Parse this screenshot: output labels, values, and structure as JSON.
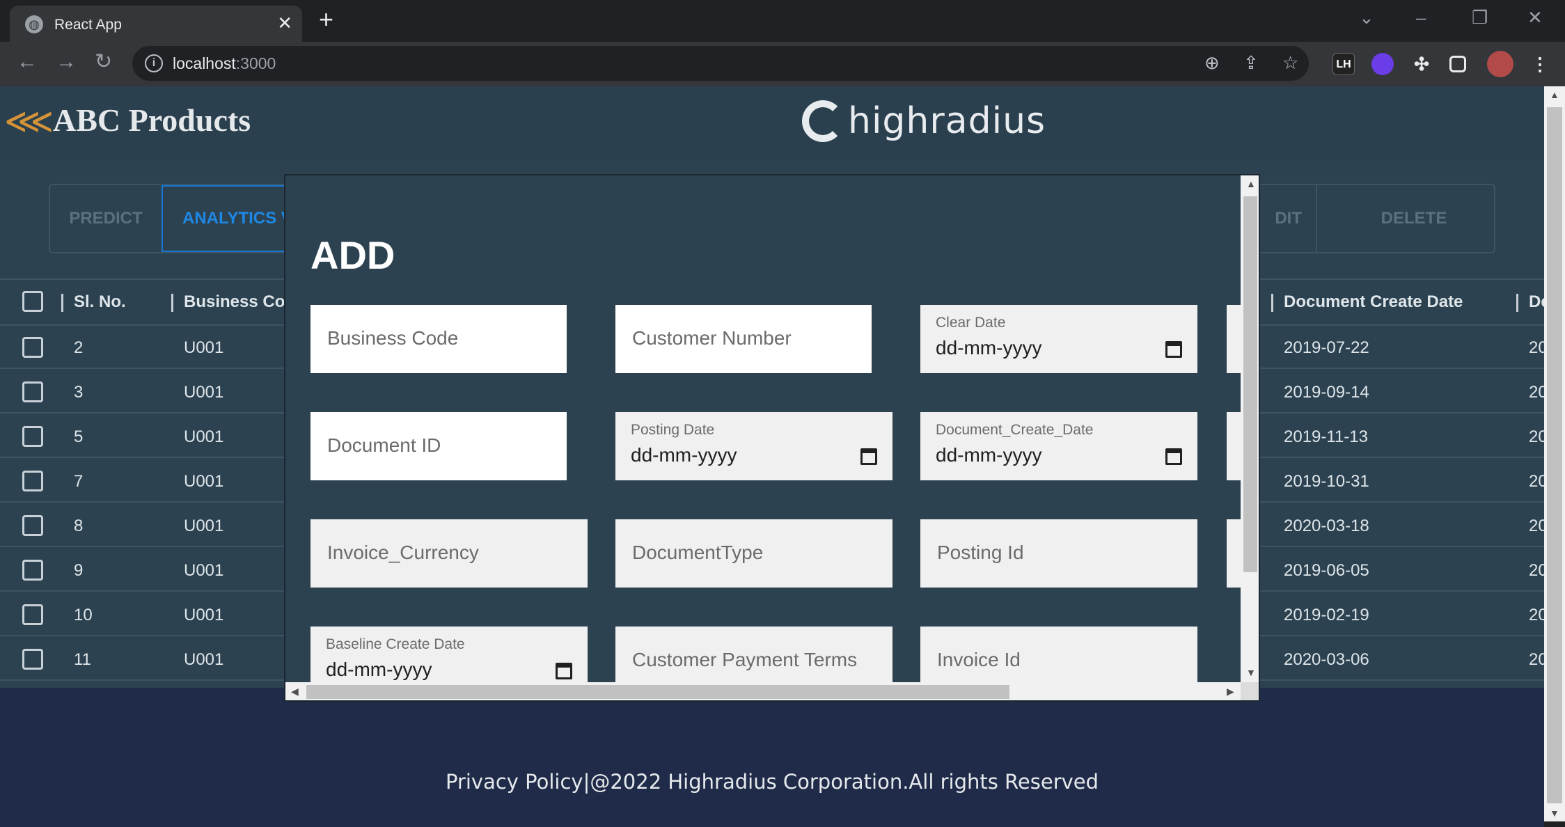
{
  "browser": {
    "tab_title": "React App",
    "tab_close": "✕",
    "new_tab": "+",
    "url_host": "localhost",
    "url_port": ":3000",
    "extensions": {
      "lh": "LH"
    }
  },
  "header": {
    "brand": "ABC Products",
    "partner_logo": "highradius"
  },
  "actions": {
    "predict": "PREDICT",
    "analytics": "ANALYTICS V",
    "edit": "DIT",
    "delete": "DELETE"
  },
  "grid": {
    "columns": {
      "sl_no": "Sl. No.",
      "business_code": "Business Co",
      "document_create_date": "Document Create Date",
      "next": "De"
    },
    "rows": [
      {
        "sl_no": "2",
        "business_code": "U001",
        "document_create_date": "2019-07-22",
        "next": "20"
      },
      {
        "sl_no": "3",
        "business_code": "U001",
        "document_create_date": "2019-09-14",
        "next": "20"
      },
      {
        "sl_no": "5",
        "business_code": "U001",
        "document_create_date": "2019-11-13",
        "next": "20"
      },
      {
        "sl_no": "7",
        "business_code": "U001",
        "document_create_date": "2019-10-31",
        "next": "20"
      },
      {
        "sl_no": "8",
        "business_code": "U001",
        "document_create_date": "2020-03-18",
        "next": "20"
      },
      {
        "sl_no": "9",
        "business_code": "U001",
        "document_create_date": "2019-06-05",
        "next": "20"
      },
      {
        "sl_no": "10",
        "business_code": "U001",
        "document_create_date": "2019-02-19",
        "next": "20"
      },
      {
        "sl_no": "11",
        "business_code": "U001",
        "document_create_date": "2020-03-06",
        "next": "20"
      }
    ]
  },
  "modal": {
    "title": "ADD",
    "fields": {
      "business_code": {
        "placeholder": "Business Code"
      },
      "customer_number": {
        "placeholder": "Customer Number"
      },
      "clear_date": {
        "label": "Clear Date",
        "value": "dd-mm-yyyy"
      },
      "document_id": {
        "placeholder": "Document ID"
      },
      "posting_date": {
        "label": "Posting Date",
        "value": "dd-mm-yyyy"
      },
      "document_create_date": {
        "label": "Document_Create_Date",
        "value": "dd-mm-yyyy"
      },
      "invoice_currency": {
        "placeholder": "Invoice_Currency"
      },
      "document_type": {
        "placeholder": "DocumentType"
      },
      "posting_id": {
        "placeholder": "Posting Id"
      },
      "baseline_create_date": {
        "label": "Baseline Create Date",
        "value": "dd-mm-yyyy"
      },
      "customer_payment_terms": {
        "placeholder": "Customer Payment Terms"
      },
      "invoice_id": {
        "placeholder": "Invoice Id"
      }
    }
  },
  "footer": {
    "text": "Privacy Policy|@2022 Highradius Corporation.All rights Reserved"
  },
  "colors": {
    "header_bg": "#2b404e",
    "page_bg": "#2c4250",
    "footer_bg": "#1f2b48",
    "accent": "#1e88e5",
    "brand_logo": "#d49338"
  }
}
